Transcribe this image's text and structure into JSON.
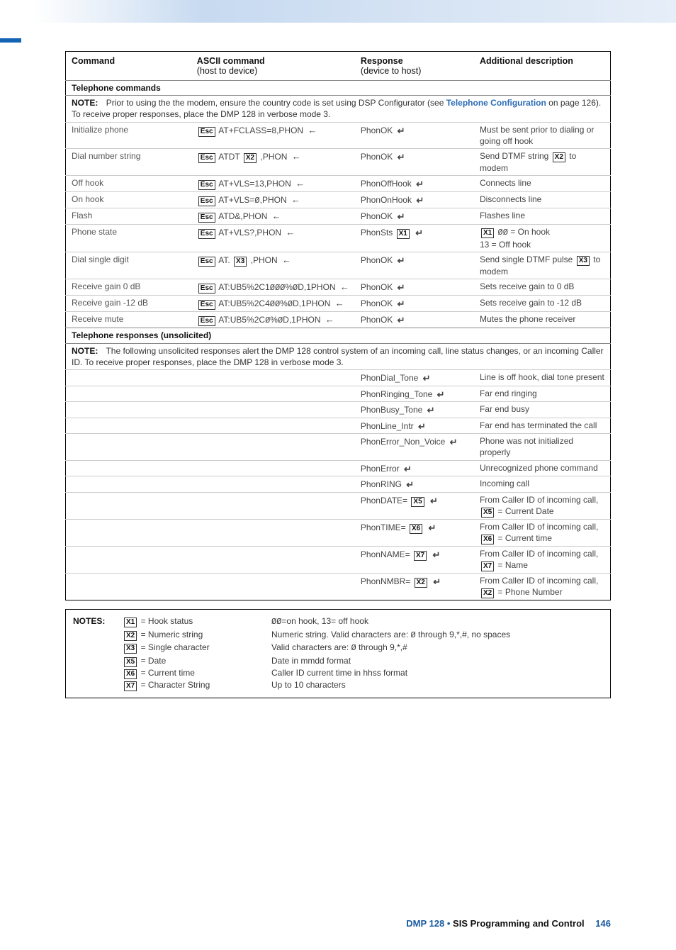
{
  "headers": {
    "c1": "Command",
    "c2a": "ASCII command",
    "c2b": "(host to device)",
    "c3a": "Response",
    "c3b": "(device to host)",
    "c4": "Additional description"
  },
  "sections": {
    "tel_cmds": "Telephone commands",
    "tel_resp": "Telephone responses (unsolicited)"
  },
  "note1": {
    "label": "NOTE:",
    "text_a": "Prior to using the the modem, ensure the country code is set using DSP Configurator (see ",
    "link": "Telephone Configuration",
    "text_b": " on page 126). To receive proper responses, place the DMP 128 in verbose mode 3."
  },
  "note2": {
    "label": "NOTE:",
    "text": "The following unsolicited responses alert the DMP 128 control system of an incoming call, line status changes, or an incoming Caller ID. To receive proper responses, place the DMP 128 in verbose mode 3."
  },
  "rows": [
    {
      "cmd": "Initialize phone",
      "asc": "[Esc] AT+FCLASS=8,PHON ←",
      "resp": "PhonOK ↵",
      "desc": "Must be sent prior to dialing or going off hook"
    },
    {
      "cmd": "Dial number string",
      "asc": "[Esc] ATDT [X2] ,PHON ←",
      "resp": "PhonOK ↵",
      "desc": "Send DTMF string [X2] to modem"
    },
    {
      "cmd": "Off hook",
      "asc": "[Esc] AT+VLS=13,PHON ←",
      "resp": "PhonOffHook ↵",
      "desc": "Connects line"
    },
    {
      "cmd": "On hook",
      "asc": "[Esc] AT+VLS=Ø,PHON ←",
      "resp": "PhonOnHook ↵",
      "desc": "Disconnects line"
    },
    {
      "cmd": "Flash",
      "asc": "[Esc] ATD&,PHON ←",
      "resp": "PhonOK ↵",
      "desc": "Flashes line"
    },
    {
      "cmd": "Phone state",
      "asc": "[Esc] AT+VLS?,PHON ←",
      "resp": "PhonSts [X1] ↵",
      "desc": "[X1]  ØØ = On hook\n       13 = Off hook"
    },
    {
      "cmd": "Dial single digit",
      "asc": "[Esc] AT. [X3] ,PHON ←",
      "resp": "PhonOK ↵",
      "desc": "Send single DTMF pulse [X3] to modem"
    },
    {
      "cmd": "Receive gain 0 dB",
      "asc": "[Esc] AT:UB5%2C1ØØØ%ØD,1PHON ←",
      "resp": "PhonOK ↵",
      "desc": "Sets receive gain to 0 dB"
    },
    {
      "cmd": "Receive gain -12 dB",
      "asc": "[Esc] AT:UB5%2C4ØØ%ØD,1PHON ←",
      "resp": "PhonOK ↵",
      "desc": "Sets receive gain to -12 dB"
    },
    {
      "cmd": "Receive mute",
      "asc": "[Esc] AT:UB5%2CØ%ØD,1PHON ←",
      "resp": "PhonOK ↵",
      "desc": "Mutes the phone receiver"
    }
  ],
  "urows": [
    {
      "resp": "PhonDial_Tone ↵",
      "desc": "Line is off hook, dial tone present"
    },
    {
      "resp": "PhonRinging_Tone ↵",
      "desc": "Far end ringing"
    },
    {
      "resp": "PhonBusy_Tone ↵",
      "desc": "Far end busy"
    },
    {
      "resp": "PhonLine_Intr ↵",
      "desc": "Far end has terminated the call"
    },
    {
      "resp": "PhonError_Non_Voice ↵",
      "desc": "Phone was not initialized properly"
    },
    {
      "resp": "PhonError ↵",
      "desc": "Unrecognized phone command"
    },
    {
      "resp": "PhonRING ↵",
      "desc": "Incoming call"
    },
    {
      "resp": "PhonDATE= [X5] ↵",
      "desc": "From Caller ID of incoming call, [X5] = Current Date"
    },
    {
      "resp": "PhonTIME= [X6] ↵",
      "desc": "From Caller ID of incoming call, [X6] = Current time"
    },
    {
      "resp": "PhonNAME= [X7] ↵",
      "desc": "From Caller ID of incoming call, [X7] = Name"
    },
    {
      "resp": "PhonNMBR= [X2] ↵",
      "desc": "From Caller ID of incoming call, [X2] = Phone Number"
    }
  ],
  "notesbox": {
    "label": "NOTES:",
    "items": [
      {
        "xa": "X1",
        "a": " = Hook status",
        "b": "ØØ=on hook, 13= off hook"
      },
      {
        "xa": "X2",
        "a": " = Numeric string",
        "b": "Numeric string. Valid characters are: Ø through 9,*,#, no spaces"
      },
      {
        "xa": "X3",
        "a": " = Single character",
        "b": "Valid characters are: Ø through 9,*,#"
      },
      {
        "xa": "X5",
        "a": " = Date",
        "b": "Date in mmdd format"
      },
      {
        "xa": "X6",
        "a": " = Current time",
        "b": "Caller ID current time in hhss format"
      },
      {
        "xa": "X7",
        "a": " = Character String",
        "b": "Up to 10 characters"
      }
    ]
  },
  "footer": {
    "product": "DMP 128",
    "sep": " • ",
    "section": "SIS Programming and Control",
    "page": "146"
  }
}
